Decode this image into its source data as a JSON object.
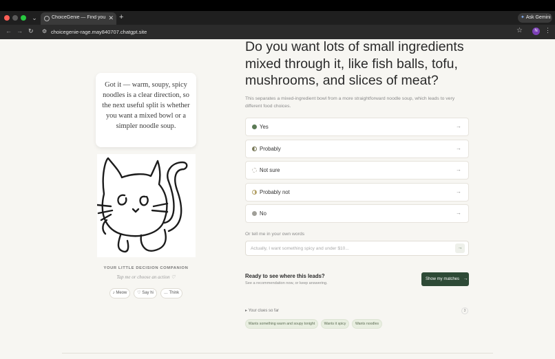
{
  "browser": {
    "tab_title": "ChoiceGenie — Find your cla",
    "url": "choicegenie-rage.may840707.chatgpt.site",
    "ask_gemini": "Ask Gemini",
    "profile_initial": "N",
    "colors": {
      "close": "#ff5f57",
      "minimize": "#febc2e",
      "maximize": "#28c840"
    }
  },
  "companion": {
    "message": "Got it — warm, soupy, spicy noodles is a clear direction, so the next useful split is whether you want a mixed bowl or a simpler noodle soup.",
    "label": "YOUR LITTLE DECISION COMPANION",
    "hint": "Tap me or choose an action ♡",
    "actions": [
      {
        "icon": "♪",
        "label": "Meow"
      },
      {
        "icon": "♡",
        "label": "Say hi"
      },
      {
        "icon": "…",
        "label": "Think"
      }
    ]
  },
  "question": {
    "title": "Do you want lots of small ingredients mixed through it, like fish balls, tofu, mushrooms, and slices of meat?",
    "description": "This separates a mixed-ingredient bowl from a more straightforward noodle soup, which leads to very different food choices."
  },
  "options": [
    {
      "label": "Yes",
      "icon": "full"
    },
    {
      "label": "Probably",
      "icon": "half"
    },
    {
      "label": "Not sure",
      "icon": "empty"
    },
    {
      "label": "Probably not",
      "icon": "quarter"
    },
    {
      "label": "No",
      "icon": "grey"
    }
  ],
  "own_words": {
    "label": "Or tell me in your own words",
    "placeholder": "Actually, I want something spicy and under $10..."
  },
  "ready": {
    "title": "Ready to see where this leads?",
    "subtitle": "See a recommendation now, or keep answering.",
    "button": "Show my matches"
  },
  "clues": {
    "toggle": "▸ Your clues so far",
    "count": "3",
    "items": [
      "Wants something warm and soupy tonight",
      "Wants it spicy",
      "Wants noodles"
    ]
  }
}
